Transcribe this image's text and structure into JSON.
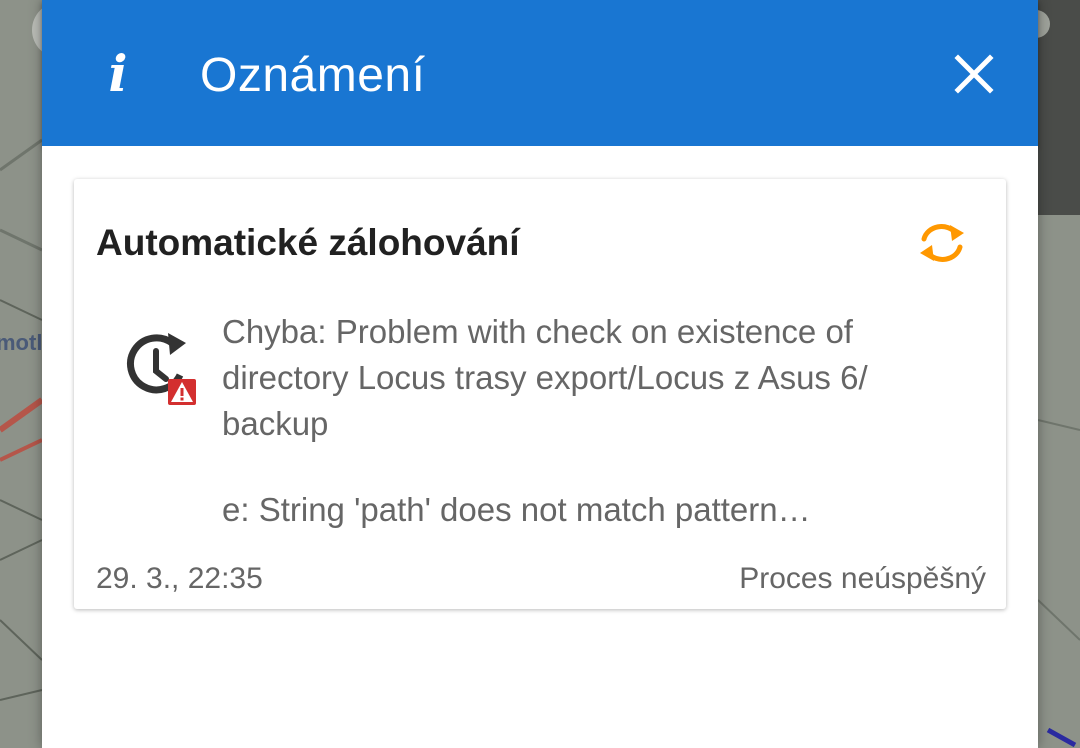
{
  "dialog": {
    "title": "Oznámení",
    "info_icon": "info-icon",
    "close_icon": "close-icon",
    "header_color": "#1976d2"
  },
  "map": {
    "partial_label": "motl"
  },
  "notification": {
    "title": "Automatické zálohování",
    "action_icon": "sync-icon",
    "action_color": "#ff9800",
    "type_icon": "backup-history-error-icon",
    "message_lines": [
      "Chyba: Problem with check on existence of",
      "directory Locus trasy export/Locus z Asus 6/",
      "backup"
    ],
    "detail_line": "e: String 'path' does not match pattern…",
    "date": "29. 3., 22:35",
    "status": "Proces neúspěšný"
  }
}
